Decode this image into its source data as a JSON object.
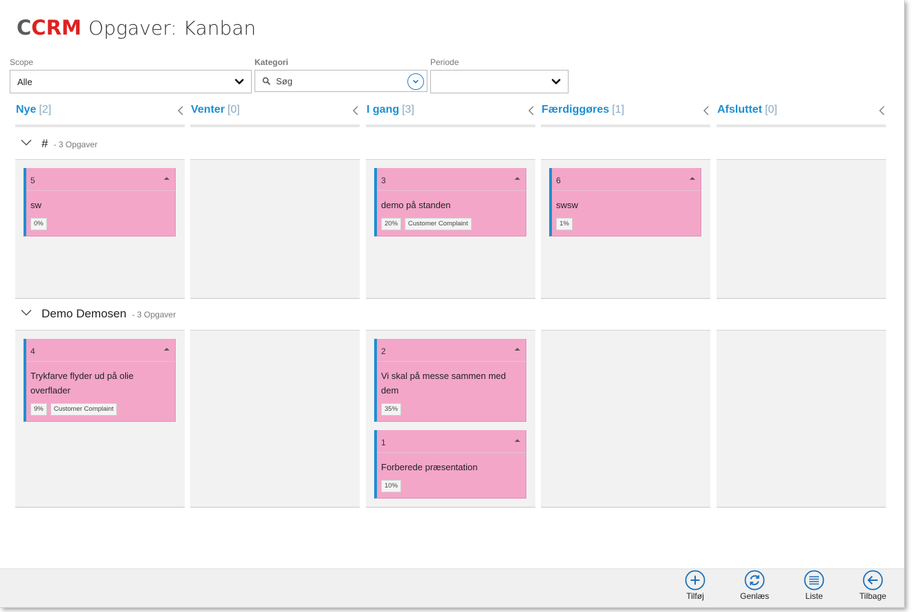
{
  "app": {
    "logo_text_first": "C",
    "logo_text_rest": "CRM",
    "page_title": "Opgaver: Kanban",
    "brand_color": "#e02020",
    "accent_color": "#1e8fd0",
    "card_color": "#f3a6c8"
  },
  "filters": {
    "scope": {
      "label": "Scope",
      "value": "Alle"
    },
    "kategori": {
      "label": "Kategori",
      "placeholder": "Søg"
    },
    "periode": {
      "label": "Periode",
      "value": ""
    }
  },
  "columns": [
    {
      "title": "Nye",
      "count": "[2]"
    },
    {
      "title": "Venter",
      "count": "[0]"
    },
    {
      "title": "I gang",
      "count": "[3]"
    },
    {
      "title": "Færdiggøres",
      "count": "[1]"
    },
    {
      "title": "Afsluttet",
      "count": "[0]"
    }
  ],
  "groups": [
    {
      "name": "#",
      "count_text": "- 3 Opgaver",
      "cards": [
        {
          "column": "Nye",
          "number": "5",
          "title": "sw",
          "progress": "0%",
          "category": ""
        },
        {
          "column": "I gang",
          "number": "3",
          "title": "demo på standen",
          "progress": "20%",
          "category": "Customer Complaint"
        },
        {
          "column": "Færdiggøres",
          "number": "6",
          "title": "swsw",
          "progress": "1%",
          "category": ""
        }
      ]
    },
    {
      "name": "Demo Demosen",
      "count_text": "- 3 Opgaver",
      "cards": [
        {
          "column": "Nye",
          "number": "4",
          "title": "Trykfarve flyder ud på olie overflader",
          "progress": "9%",
          "category": "Customer Complaint"
        },
        {
          "column": "I gang",
          "number": "2",
          "title": "Vi skal på messe sammen med dem",
          "progress": "35%",
          "category": ""
        },
        {
          "column": "I gang",
          "number": "1",
          "title": "Forberede præsentation",
          "progress": "10%",
          "category": ""
        }
      ]
    }
  ],
  "actions": [
    {
      "label": "Tilføj",
      "icon": "plus-icon"
    },
    {
      "label": "Genlæs",
      "icon": "refresh-icon"
    },
    {
      "label": "Liste",
      "icon": "list-icon"
    },
    {
      "label": "Tilbage",
      "icon": "back-arrow-icon"
    }
  ]
}
